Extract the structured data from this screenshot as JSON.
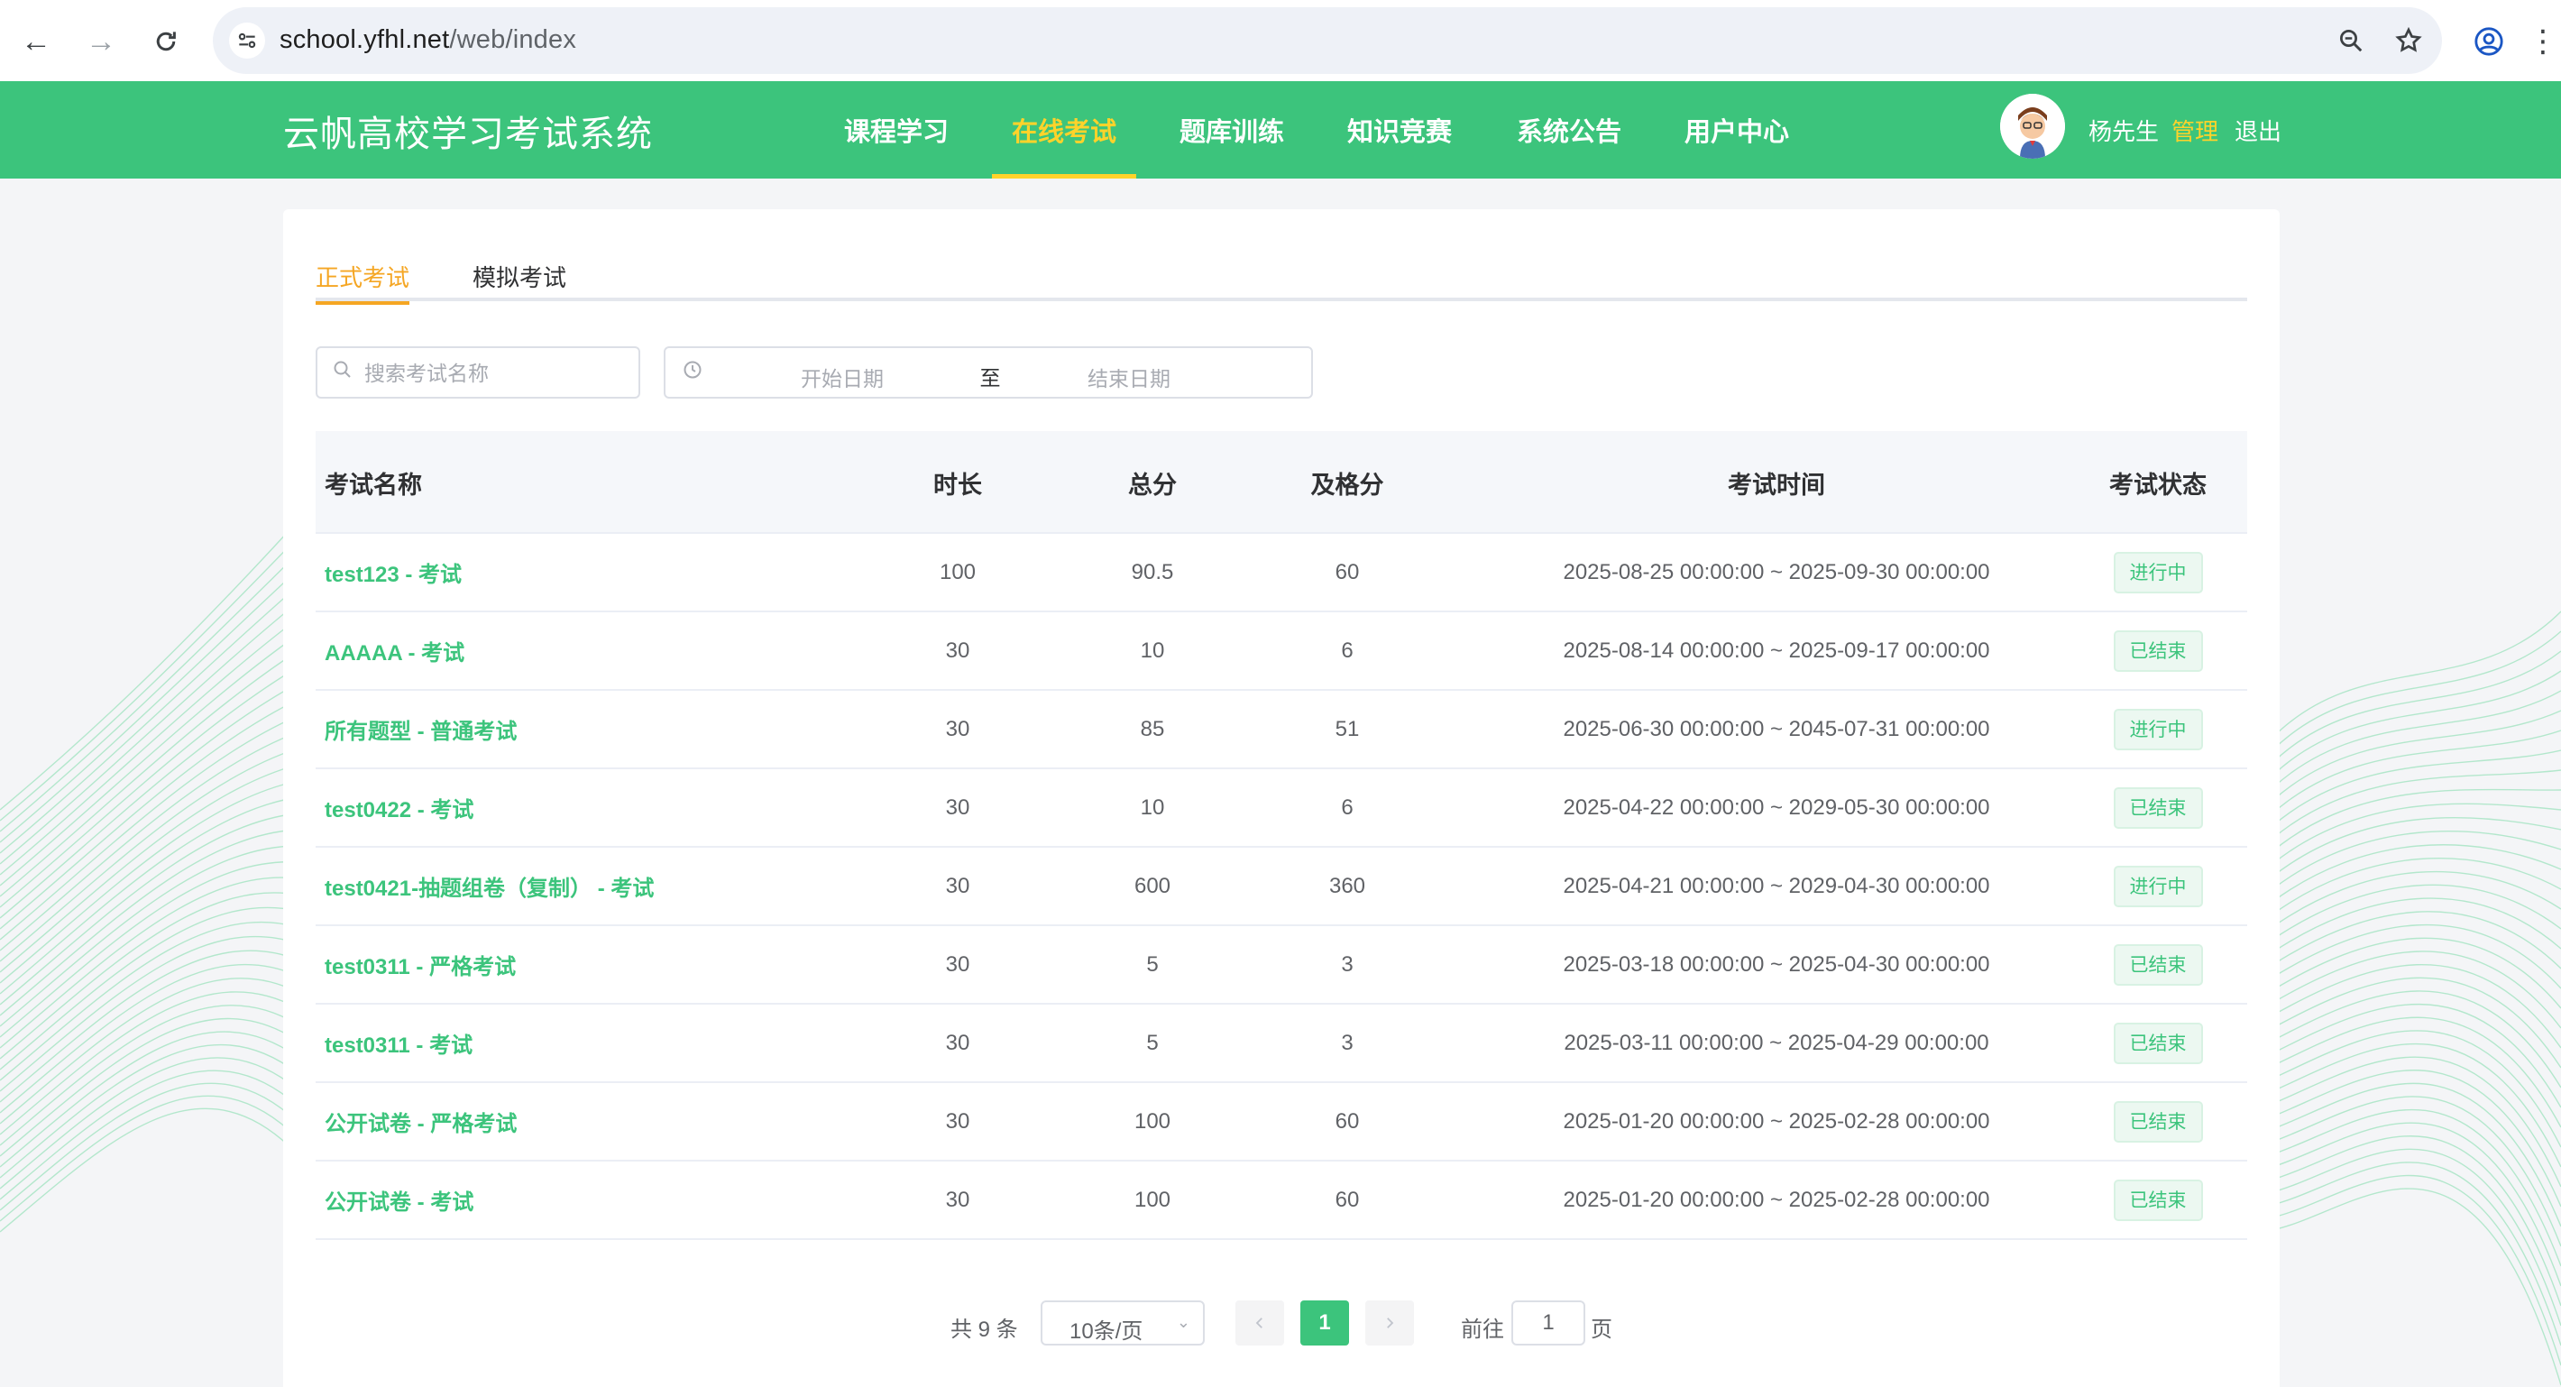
{
  "browser": {
    "url_host": "school.yfhl.net",
    "url_path": "/web/index"
  },
  "header": {
    "site_title": "云帆高校学习考试系统",
    "nav": [
      {
        "label": "课程学习",
        "active": false
      },
      {
        "label": "在线考试",
        "active": true
      },
      {
        "label": "题库训练",
        "active": false
      },
      {
        "label": "知识竞赛",
        "active": false
      },
      {
        "label": "系统公告",
        "active": false
      },
      {
        "label": "用户中心",
        "active": false
      }
    ],
    "user_name": "杨先生",
    "admin_label": "管理",
    "logout_label": "退出"
  },
  "tabs": [
    {
      "label": "正式考试",
      "active": true
    },
    {
      "label": "模拟考试",
      "active": false
    }
  ],
  "filters": {
    "search_placeholder": "搜索考试名称",
    "start_date_placeholder": "开始日期",
    "range_separator": "至",
    "end_date_placeholder": "结束日期"
  },
  "table": {
    "columns": [
      "考试名称",
      "时长",
      "总分",
      "及格分",
      "考试时间",
      "考试状态"
    ],
    "rows": [
      {
        "name": "test123 - 考试",
        "duration": "100",
        "total": "90.5",
        "pass": "60",
        "time": "2025-08-25 00:00:00 ~ 2025-09-30 00:00:00",
        "status": "进行中"
      },
      {
        "name": "AAAAA - 考试",
        "duration": "30",
        "total": "10",
        "pass": "6",
        "time": "2025-08-14 00:00:00 ~ 2025-09-17 00:00:00",
        "status": "已结束"
      },
      {
        "name": "所有题型 - 普通考试",
        "duration": "30",
        "total": "85",
        "pass": "51",
        "time": "2025-06-30 00:00:00 ~ 2045-07-31 00:00:00",
        "status": "进行中"
      },
      {
        "name": "test0422 - 考试",
        "duration": "30",
        "total": "10",
        "pass": "6",
        "time": "2025-04-22 00:00:00 ~ 2029-05-30 00:00:00",
        "status": "已结束"
      },
      {
        "name": "test0421-抽题组卷（复制） - 考试",
        "duration": "30",
        "total": "600",
        "pass": "360",
        "time": "2025-04-21 00:00:00 ~ 2029-04-30 00:00:00",
        "status": "进行中"
      },
      {
        "name": "test0311 - 严格考试",
        "duration": "30",
        "total": "5",
        "pass": "3",
        "time": "2025-03-18 00:00:00 ~ 2025-04-30 00:00:00",
        "status": "已结束"
      },
      {
        "name": "test0311 - 考试",
        "duration": "30",
        "total": "5",
        "pass": "3",
        "time": "2025-03-11 00:00:00 ~ 2025-04-29 00:00:00",
        "status": "已结束"
      },
      {
        "name": "公开试卷 - 严格考试",
        "duration": "30",
        "total": "100",
        "pass": "60",
        "time": "2025-01-20 00:00:00 ~ 2025-02-28 00:00:00",
        "status": "已结束"
      },
      {
        "name": "公开试卷 - 考试",
        "duration": "30",
        "total": "100",
        "pass": "60",
        "time": "2025-01-20 00:00:00 ~ 2025-02-28 00:00:00",
        "status": "已结束"
      }
    ]
  },
  "pagination": {
    "total_text": "共 9 条",
    "page_size": "10条/页",
    "current_page": "1",
    "goto_label": "前往",
    "goto_value": "1",
    "goto_suffix": "页"
  },
  "colors": {
    "brand_green": "#3cc47c",
    "accent_yellow": "#ffd32a",
    "tab_orange": "#f5a623"
  }
}
